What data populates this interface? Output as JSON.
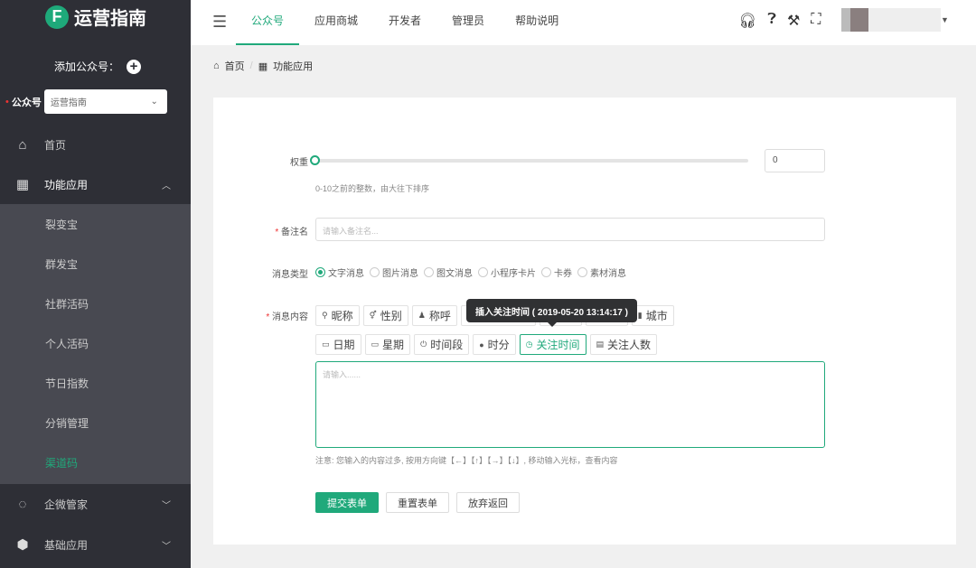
{
  "sidebar": {
    "logo": "运营指南",
    "logo_letter": "F",
    "add_account_label": "添加公众号：",
    "account_label": "公众号",
    "account_select": "运营指南",
    "items": [
      {
        "label": "首页",
        "icon": "home-icon"
      },
      {
        "label": "功能应用",
        "icon": "grid-icon",
        "expanded": true
      },
      {
        "label": "企微管家",
        "icon": "chat-icon"
      },
      {
        "label": "基础应用",
        "icon": "cube-icon"
      }
    ],
    "sub_items": [
      "裂变宝",
      "群发宝",
      "社群活码",
      "个人活码",
      "节日指数",
      "分销管理",
      "渠道码"
    ],
    "active_sub": "渠道码"
  },
  "header": {
    "tabs": [
      "公众号",
      "应用商城",
      "开发者",
      "管理员",
      "帮助说明"
    ],
    "active_tab": "公众号",
    "icons": [
      "headset-icon",
      "help-icon",
      "tools-icon",
      "fullscreen-icon"
    ]
  },
  "breadcrumb": [
    "首页",
    "功能应用"
  ],
  "form": {
    "weight_label": "权重",
    "weight_value": "0",
    "weight_percent": 0,
    "weight_hint": "0-10之前的整数，由大往下排序",
    "remark_label": "备注名",
    "remark_placeholder": "请输入备注名...",
    "type_label": "消息类型",
    "types": [
      "文字消息",
      "图片消息",
      "图文消息",
      "小程序卡片",
      "卡券",
      "素材消息"
    ],
    "selected_type": "文字消息",
    "content_label": "消息内容",
    "vars_row1": [
      {
        "icon": "user-icon",
        "glyph": "⚲",
        "label": "昵称"
      },
      {
        "icon": "gender-icon",
        "glyph": "⚥",
        "label": "性别"
      },
      {
        "icon": "person-icon",
        "glyph": "♟",
        "label": "称呼"
      },
      {
        "icon": "tag-icon",
        "glyph": "▯",
        "label": "公众号名称"
      },
      {
        "icon": "flag-icon",
        "glyph": "▮",
        "label": "国家"
      },
      {
        "icon": "flag-icon",
        "glyph": "▮",
        "label": "省份"
      },
      {
        "icon": "flag-icon",
        "glyph": "▮",
        "label": "城市"
      }
    ],
    "vars_row2": [
      {
        "icon": "calendar-icon",
        "glyph": "▭",
        "label": "日期"
      },
      {
        "icon": "calendar-icon",
        "glyph": "▭",
        "label": "星期"
      },
      {
        "icon": "power-icon",
        "glyph": "⏻",
        "label": "时间段"
      },
      {
        "icon": "globe-icon",
        "glyph": "●",
        "label": "时分"
      },
      {
        "icon": "clock-icon",
        "glyph": "◷",
        "label": "关注时间"
      },
      {
        "icon": "calculator-icon",
        "glyph": "▤",
        "label": "关注人数"
      }
    ],
    "tooltip": "插入关注时间 ( 2019-05-20 13:14:17 )",
    "content_placeholder": "请输入......",
    "content_hint": "注意: 您输入的内容过多, 按用方向键【←】【↑】【→】【↓】, 移动输入光标，查看内容",
    "submit": "提交表单",
    "reset": "重置表单",
    "cancel": "放弃返回"
  },
  "colors": {
    "accent": "#20a97b",
    "sidebar": "#2e2f36",
    "submenu": "#484951"
  }
}
